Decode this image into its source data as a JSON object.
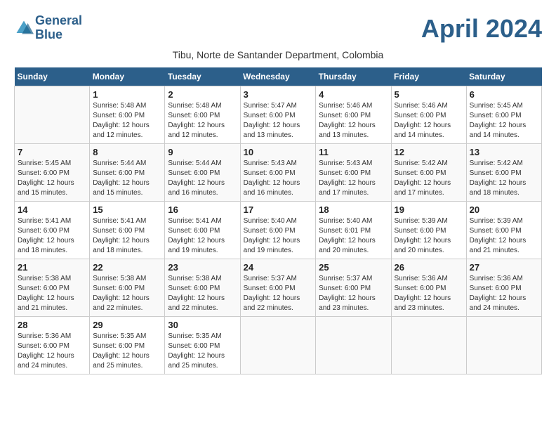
{
  "logo": {
    "line1": "General",
    "line2": "Blue"
  },
  "title": "April 2024",
  "subtitle": "Tibu, Norte de Santander Department, Colombia",
  "days_of_week": [
    "Sunday",
    "Monday",
    "Tuesday",
    "Wednesday",
    "Thursday",
    "Friday",
    "Saturday"
  ],
  "weeks": [
    [
      {
        "day": "",
        "sunrise": "",
        "sunset": "",
        "daylight": ""
      },
      {
        "day": "1",
        "sunrise": "Sunrise: 5:48 AM",
        "sunset": "Sunset: 6:00 PM",
        "daylight": "Daylight: 12 hours and 12 minutes."
      },
      {
        "day": "2",
        "sunrise": "Sunrise: 5:48 AM",
        "sunset": "Sunset: 6:00 PM",
        "daylight": "Daylight: 12 hours and 12 minutes."
      },
      {
        "day": "3",
        "sunrise": "Sunrise: 5:47 AM",
        "sunset": "Sunset: 6:00 PM",
        "daylight": "Daylight: 12 hours and 13 minutes."
      },
      {
        "day": "4",
        "sunrise": "Sunrise: 5:46 AM",
        "sunset": "Sunset: 6:00 PM",
        "daylight": "Daylight: 12 hours and 13 minutes."
      },
      {
        "day": "5",
        "sunrise": "Sunrise: 5:46 AM",
        "sunset": "Sunset: 6:00 PM",
        "daylight": "Daylight: 12 hours and 14 minutes."
      },
      {
        "day": "6",
        "sunrise": "Sunrise: 5:45 AM",
        "sunset": "Sunset: 6:00 PM",
        "daylight": "Daylight: 12 hours and 14 minutes."
      }
    ],
    [
      {
        "day": "7",
        "sunrise": "Sunrise: 5:45 AM",
        "sunset": "Sunset: 6:00 PM",
        "daylight": "Daylight: 12 hours and 15 minutes."
      },
      {
        "day": "8",
        "sunrise": "Sunrise: 5:44 AM",
        "sunset": "Sunset: 6:00 PM",
        "daylight": "Daylight: 12 hours and 15 minutes."
      },
      {
        "day": "9",
        "sunrise": "Sunrise: 5:44 AM",
        "sunset": "Sunset: 6:00 PM",
        "daylight": "Daylight: 12 hours and 16 minutes."
      },
      {
        "day": "10",
        "sunrise": "Sunrise: 5:43 AM",
        "sunset": "Sunset: 6:00 PM",
        "daylight": "Daylight: 12 hours and 16 minutes."
      },
      {
        "day": "11",
        "sunrise": "Sunrise: 5:43 AM",
        "sunset": "Sunset: 6:00 PM",
        "daylight": "Daylight: 12 hours and 17 minutes."
      },
      {
        "day": "12",
        "sunrise": "Sunrise: 5:42 AM",
        "sunset": "Sunset: 6:00 PM",
        "daylight": "Daylight: 12 hours and 17 minutes."
      },
      {
        "day": "13",
        "sunrise": "Sunrise: 5:42 AM",
        "sunset": "Sunset: 6:00 PM",
        "daylight": "Daylight: 12 hours and 18 minutes."
      }
    ],
    [
      {
        "day": "14",
        "sunrise": "Sunrise: 5:41 AM",
        "sunset": "Sunset: 6:00 PM",
        "daylight": "Daylight: 12 hours and 18 minutes."
      },
      {
        "day": "15",
        "sunrise": "Sunrise: 5:41 AM",
        "sunset": "Sunset: 6:00 PM",
        "daylight": "Daylight: 12 hours and 18 minutes."
      },
      {
        "day": "16",
        "sunrise": "Sunrise: 5:41 AM",
        "sunset": "Sunset: 6:00 PM",
        "daylight": "Daylight: 12 hours and 19 minutes."
      },
      {
        "day": "17",
        "sunrise": "Sunrise: 5:40 AM",
        "sunset": "Sunset: 6:00 PM",
        "daylight": "Daylight: 12 hours and 19 minutes."
      },
      {
        "day": "18",
        "sunrise": "Sunrise: 5:40 AM",
        "sunset": "Sunset: 6:01 PM",
        "daylight": "Daylight: 12 hours and 20 minutes."
      },
      {
        "day": "19",
        "sunrise": "Sunrise: 5:39 AM",
        "sunset": "Sunset: 6:00 PM",
        "daylight": "Daylight: 12 hours and 20 minutes."
      },
      {
        "day": "20",
        "sunrise": "Sunrise: 5:39 AM",
        "sunset": "Sunset: 6:00 PM",
        "daylight": "Daylight: 12 hours and 21 minutes."
      }
    ],
    [
      {
        "day": "21",
        "sunrise": "Sunrise: 5:38 AM",
        "sunset": "Sunset: 6:00 PM",
        "daylight": "Daylight: 12 hours and 21 minutes."
      },
      {
        "day": "22",
        "sunrise": "Sunrise: 5:38 AM",
        "sunset": "Sunset: 6:00 PM",
        "daylight": "Daylight: 12 hours and 22 minutes."
      },
      {
        "day": "23",
        "sunrise": "Sunrise: 5:38 AM",
        "sunset": "Sunset: 6:00 PM",
        "daylight": "Daylight: 12 hours and 22 minutes."
      },
      {
        "day": "24",
        "sunrise": "Sunrise: 5:37 AM",
        "sunset": "Sunset: 6:00 PM",
        "daylight": "Daylight: 12 hours and 22 minutes."
      },
      {
        "day": "25",
        "sunrise": "Sunrise: 5:37 AM",
        "sunset": "Sunset: 6:00 PM",
        "daylight": "Daylight: 12 hours and 23 minutes."
      },
      {
        "day": "26",
        "sunrise": "Sunrise: 5:36 AM",
        "sunset": "Sunset: 6:00 PM",
        "daylight": "Daylight: 12 hours and 23 minutes."
      },
      {
        "day": "27",
        "sunrise": "Sunrise: 5:36 AM",
        "sunset": "Sunset: 6:00 PM",
        "daylight": "Daylight: 12 hours and 24 minutes."
      }
    ],
    [
      {
        "day": "28",
        "sunrise": "Sunrise: 5:36 AM",
        "sunset": "Sunset: 6:00 PM",
        "daylight": "Daylight: 12 hours and 24 minutes."
      },
      {
        "day": "29",
        "sunrise": "Sunrise: 5:35 AM",
        "sunset": "Sunset: 6:00 PM",
        "daylight": "Daylight: 12 hours and 25 minutes."
      },
      {
        "day": "30",
        "sunrise": "Sunrise: 5:35 AM",
        "sunset": "Sunset: 6:00 PM",
        "daylight": "Daylight: 12 hours and 25 minutes."
      },
      {
        "day": "",
        "sunrise": "",
        "sunset": "",
        "daylight": ""
      },
      {
        "day": "",
        "sunrise": "",
        "sunset": "",
        "daylight": ""
      },
      {
        "day": "",
        "sunrise": "",
        "sunset": "",
        "daylight": ""
      },
      {
        "day": "",
        "sunrise": "",
        "sunset": "",
        "daylight": ""
      }
    ]
  ]
}
